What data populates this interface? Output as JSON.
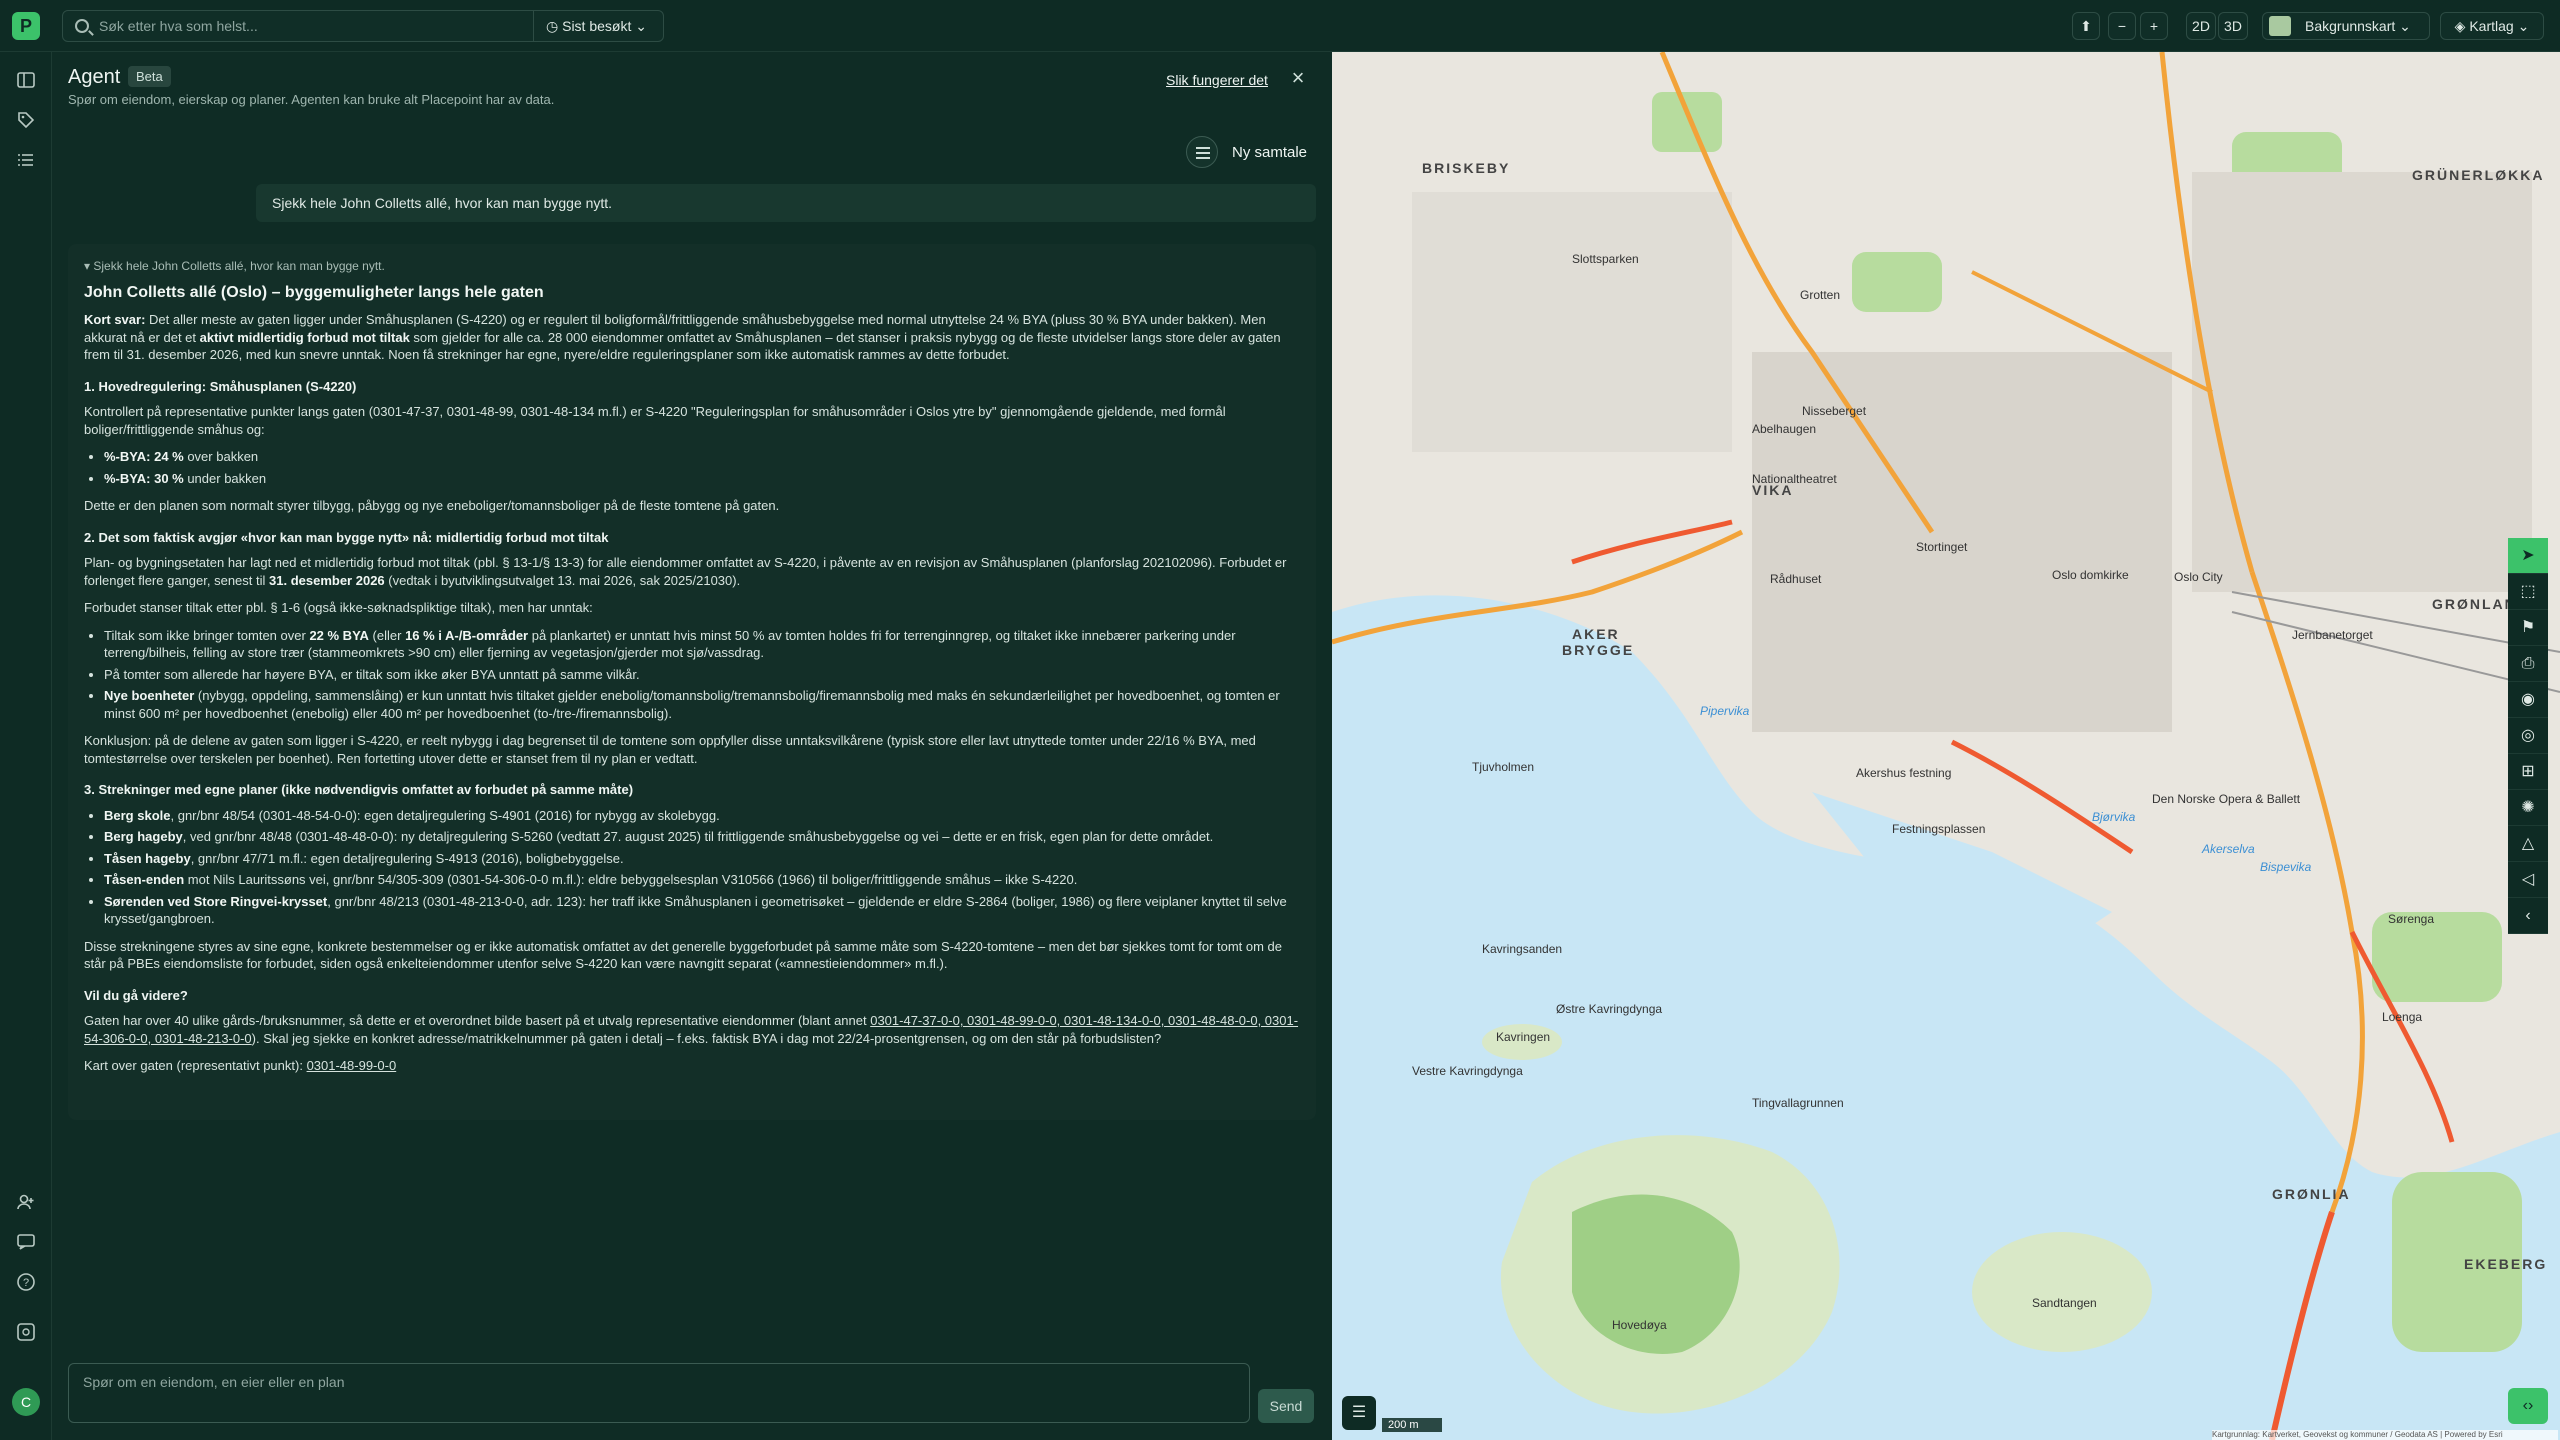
{
  "app": {
    "logo_letter": "P"
  },
  "search": {
    "placeholder": "Søk etter hva som helst...",
    "recent_label": "Sist besøkt"
  },
  "topbar": {
    "zoom_out": "−",
    "zoom_in": "+",
    "view_2d": "2D",
    "view_3d": "3D",
    "basemap_label": "Bakgrunnskart",
    "layers_label": "Kartlag"
  },
  "user": {
    "initial": "C"
  },
  "agent": {
    "title": "Agent",
    "badge": "Beta",
    "subtitle": "Spør om eiendom, eierskap og planer. Agenten kan bruke alt Placepoint har av data.",
    "how_link": "Slik fungerer det",
    "close": "×",
    "new_chat": "Ny samtale",
    "user_message": "Sjekk hele John Colletts allé, hvor kan man bygge nytt.",
    "summary": "Sjekk hele John Colletts allé, hvor kan man bygge nytt.",
    "heading": "John Colletts allé (Oslo) – byggemuligheter langs hele gaten",
    "kort_label": "Kort svar:",
    "kort_1": " Det aller meste av gaten ligger under Småhusplanen (S-4220) og er regulert til boligformål/frittliggende småhusbebyggelse med normal utnyttelse 24 % BYA (pluss 30 % BYA under bakken). Men akkurat nå er det et ",
    "kort_bold": "aktivt midlertidig forbud mot tiltak",
    "kort_2": " som gjelder for alle ca. 28 000 eiendommer omfattet av Småhusplanen – det stanser i praksis nybygg og de fleste utvidelser langs store deler av gaten frem til 31. desember 2026, med kun snevre unntak. Noen få strekninger har egne, nyere/eldre reguleringsplaner som ikke automatisk rammes av dette forbudet.",
    "h1": "1. Hovedregulering: Småhusplanen (S-4220)",
    "p1": "Kontrollert på representative punkter langs gaten (0301-47-37, 0301-48-99, 0301-48-134 m.fl.) er S-4220 \"Reguleringsplan for småhusområder i Oslos ytre by\" gjennomgående gjeldende, med formål boliger/frittliggende småhus og:",
    "bya1_label": "%-BYA: 24 %",
    "bya1_text": " over bakken",
    "bya2_label": "%-BYA: 30 %",
    "bya2_text": " under bakken",
    "p1b": "Dette er den planen som normalt styrer tilbygg, påbygg og nye eneboliger/tomannsboliger på de fleste tomtene på gaten.",
    "h2": "2. Det som faktisk avgjør «hvor kan man bygge nytt» nå: midlertidig forbud mot tiltak",
    "p2a": "Plan- og bygningsetaten har lagt ned et midlertidig forbud mot tiltak (pbl. § 13-1/§ 13-3) for alle eiendommer omfattet av S-4220, i påvente av en revisjon av Småhusplanen (planforslag 202102096). Forbudet er forlenget flere ganger, senest til ",
    "p2a_bold": "31. desember 2026",
    "p2a_end": " (vedtak i byutviklingsutvalget 13. mai 2026, sak 2025/21030).",
    "p2b": "Forbudet stanser tiltak etter pbl. § 1-6 (også ikke-søknadspliktige tiltak), men har unntak:",
    "li1_a": "Tiltak som ikke bringer tomten over ",
    "li1_b1": "22 % BYA",
    "li1_c": " (eller ",
    "li1_b2": "16 % i A-/B-områder",
    "li1_d": " på plankartet) er unntatt hvis minst 50 % av tomten holdes fri for terrenginngrep, og tiltaket ikke innebærer parkering under terreng/bilheis, felling av store trær (stammeomkrets >90 cm) eller fjerning av vegetasjon/gjerder mot sjø/vassdrag.",
    "li2": "På tomter som allerede har høyere BYA, er tiltak som ikke øker BYA unntatt på samme vilkår.",
    "li3_b": "Nye boenheter",
    "li3_t": " (nybygg, oppdeling, sammenslåing) er kun unntatt hvis tiltaket gjelder enebolig/tomannsbolig/tremannsbolig/firemannsbolig med maks én sekundærleilighet per hovedboenhet, og tomten er minst 600 m² per hovedboenhet (enebolig) eller 400 m² per hovedboenhet (to-/tre-/firemannsbolig).",
    "p2c": "Konklusjon: på de delene av gaten som ligger i S-4220, er reelt nybygg i dag begrenset til de tomtene som oppfyller disse unntaksvilkårene (typisk store eller lavt utnyttede tomter under 22/16 % BYA, med tomtestørrelse over terskelen per boenhet). Ren fortetting utover dette er stanset frem til ny plan er vedtatt.",
    "h3": "3. Strekninger med egne planer (ikke nødvendigvis omfattet av forbudet på samme måte)",
    "s1_b": "Berg skole",
    "s1_t": ", gnr/bnr 48/54 (0301-48-54-0-0): egen detaljregulering S-4901 (2016) for nybygg av skolebygg.",
    "s2_b": "Berg hageby",
    "s2_t": ", ved gnr/bnr 48/48 (0301-48-48-0-0): ny detaljregulering S-5260 (vedtatt 27. august 2025) til frittliggende småhusbebyggelse og vei – dette er en frisk, egen plan for dette området.",
    "s3_b": "Tåsen hageby",
    "s3_t": ", gnr/bnr 47/71 m.fl.: egen detaljregulering S-4913 (2016), boligbebyggelse.",
    "s4_b": "Tåsen-enden",
    "s4_t": " mot Nils Lauritssøns vei, gnr/bnr 54/305-309 (0301-54-306-0-0 m.fl.): eldre bebyggelsesplan V310566 (1966) til boliger/frittliggende småhus – ikke S-4220.",
    "s5_b": "Sørenden ved Store Ringvei-krysset",
    "s5_t": ", gnr/bnr 48/213 (0301-48-213-0-0, adr. 123): her traff ikke Småhusplanen i geometrisøket – gjeldende er eldre S-2864 (boliger, 1986) og flere veiplaner knyttet til selve krysset/gangbroen.",
    "p3": "Disse strekningene styres av sine egne, konkrete bestemmelser og er ikke automatisk omfattet av det generelle byggeforbudet på samme måte som S-4220-tomtene – men det bør sjekkes tomt for tomt om de står på PBEs eiendomsliste for forbudet, siden også enkelteiendommer utenfor selve S-4220 kan være navngitt separat («amnestieiendommer» m.fl.).",
    "h4": "Vil du gå videre?",
    "p4a": "Gaten har over 40 ulike gårds-/bruksnummer, så dette er et overordnet bilde basert på et utvalg representative eiendommer (blant annet ",
    "p4_links": "0301-47-37-0-0, 0301-48-99-0-0, 0301-48-134-0-0, 0301-48-48-0-0, 0301-54-306-0-0, 0301-48-213-0-0",
    "p4b": "). Skal jeg sjekke en konkret adresse/matrikkelnummer på gaten i detalj – f.eks. faktisk BYA i dag mot 22/24-prosentgrensen, og om den står på forbudslisten?",
    "p5a": "Kart over gaten (representativt punkt): ",
    "p5_link": "0301-48-99-0-0"
  },
  "composer": {
    "placeholder": "Spør om en eiendom, en eier eller en plan",
    "send": "Send"
  },
  "map": {
    "scale": "200 m",
    "attribution": "Kartgrunnlag: Kartverket, Geovekst og kommuner / Geodata AS | Powered by Esri",
    "labels": {
      "briskeby": "BRISKEBY",
      "grunerlokka": "GRÜNERLØKKA",
      "grønland": "GRØNLAND",
      "vika": "VIKA",
      "aker_brygge": "AKER",
      "aker_brygge2": "BRYGGE",
      "gronlia": "GRØNLIA",
      "ekeberg": "EKEBERG",
      "pipervika": "Pipervika",
      "bjorvika": "Bjørvika",
      "akerselva": "Akerselva",
      "bispevika": "Bispevika",
      "tjuvholmen": "Tjuvholmen",
      "hovedoya": "Hovedøya",
      "kavringen": "Kavringen",
      "sandtangen": "Sandtangen",
      "tingvallagrunnen": "Tingvallagrunnen",
      "ostre_kavringdynga": "Østre Kavringdynga",
      "vestre_kavringdynga": "Vestre Kavringdynga",
      "kavringsanden": "Kavringsanden",
      "nationaltheatret": "Nationaltheatret",
      "oslo_s": "Jernbanetorget",
      "radhuset": "Rådhuset",
      "operaen": "Den Norske Opera & Ballett",
      "sorenga": "Sørenga",
      "loenga": "Loenga",
      "festningsplassen": "Festningsplassen",
      "akershus": "Akershus festning",
      "stortinget": "Stortinget",
      "oslo_domkirke": "Oslo domkirke",
      "oslo_city": "Oslo City",
      "slottsparken": "Slottsparken",
      "grotten": "Grotten",
      "abelhaugen": "Abelhaugen",
      "nisseberget": "Nisseberget"
    }
  },
  "colors": {
    "accent": "#3cc26a",
    "panel": "#0f2c25",
    "map_bg": "#e9e6df",
    "water": "#c8e6f5",
    "road": "#f2a33a",
    "highlight": "#ef5a31"
  }
}
